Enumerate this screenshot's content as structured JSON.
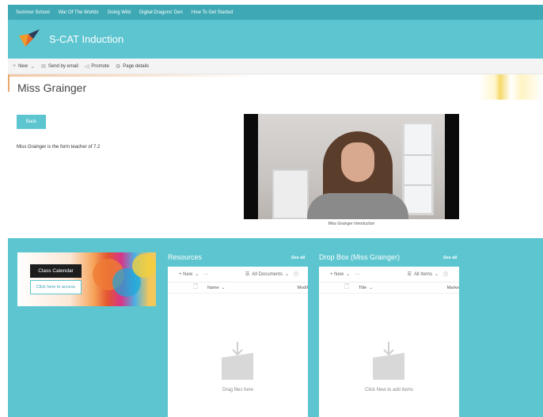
{
  "top_nav": {
    "items": [
      "Summer School",
      "War Of The Worlds",
      "Going Wild",
      "Digital Dragons' Den",
      "How To Get Started"
    ]
  },
  "site": {
    "title": "S-CAT Induction"
  },
  "command_bar": {
    "new_label": "New",
    "send_email_label": "Send by email",
    "promote_label": "Promote",
    "page_details_label": "Page details"
  },
  "page": {
    "title": "Miss Grainger",
    "back_label": "Back",
    "intro_text": "Miss Grainger is the form teacher of 7.2",
    "video_caption": "Miss Grainger Introduction"
  },
  "calendar": {
    "label": "Class Calendar",
    "link": "Click here to access"
  },
  "resources": {
    "title": "Resources",
    "see_all": "See all",
    "new_label": "+ New",
    "more": "···",
    "view_label": "All Documents",
    "column_name": "Name",
    "column_modified": "Modif",
    "empty_text": "Drag files here"
  },
  "dropbox": {
    "title": "Drop Box (Miss Grainger)",
    "see_all": "See all",
    "new_label": "+ New",
    "more": "···",
    "view_label": "All Items",
    "column_title": "Title",
    "column_marker": "Marke",
    "empty_text": "Click New to add items"
  },
  "colors": {
    "teal": "#5cc5d0",
    "nav_teal": "#3ea9b4"
  }
}
